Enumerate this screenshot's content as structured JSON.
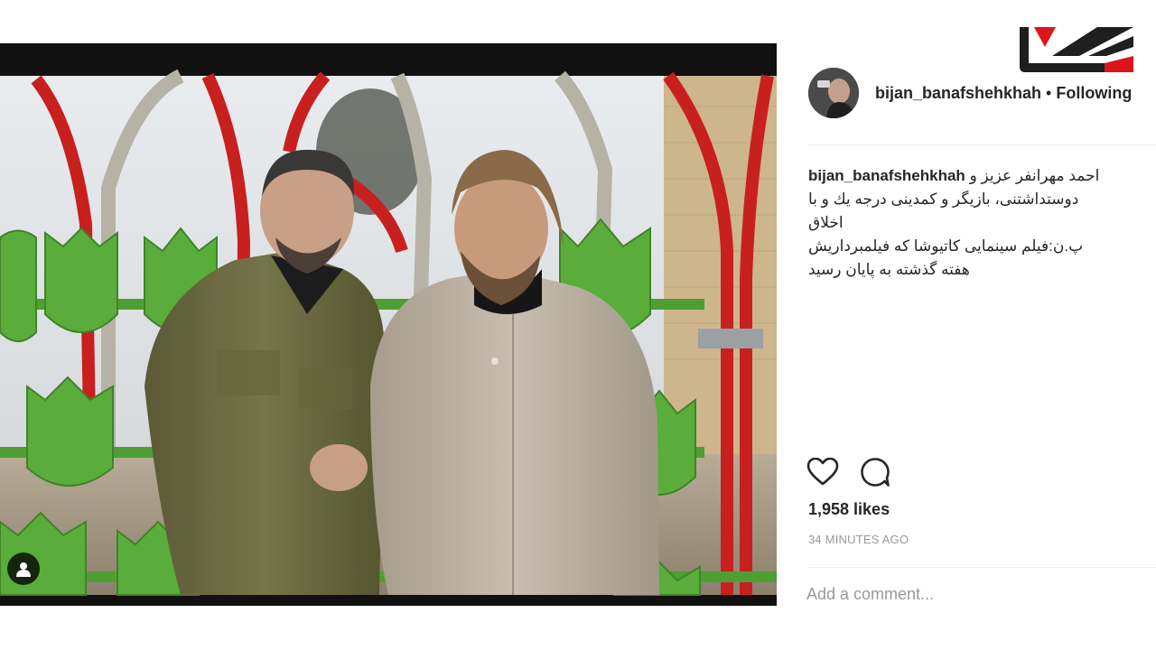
{
  "watermark": {
    "logo_name": "rokna-logo",
    "accent": "#d9161c",
    "dark": "#1f1f1f"
  },
  "post": {
    "username": "bijan_banafshehkhah",
    "separator": "•",
    "follow_state": "Following",
    "caption": {
      "username": "bijan_banafshehkhah",
      "line1": "احمد مهرانفر عزیز و",
      "line2": "دوستداشتنی، بازیگر و کمدینی درجه یك و با",
      "line3": "اخلاق",
      "line4": "پ.ن:فیلم سینمایی کاتیوشا که فیلمبرداریش",
      "line5": "هفته گذشته به پایان رسید"
    },
    "likes": "1,958 likes",
    "timestamp": "34 MINUTES AGO",
    "comment_placeholder": "Add a comment...",
    "icons": {
      "like": "heart-icon",
      "comment": "comment-bubble-icon",
      "tag": "user-tag-icon"
    }
  }
}
